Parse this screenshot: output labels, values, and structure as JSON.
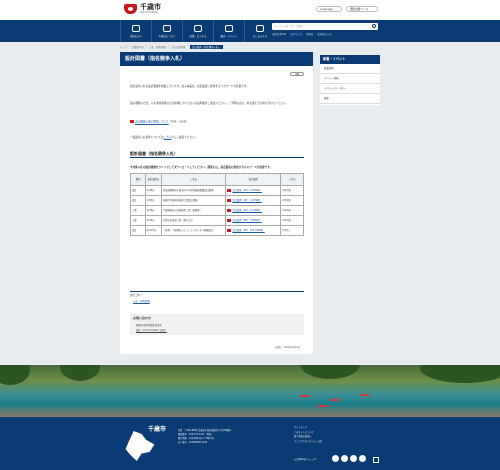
{
  "header": {
    "logo_name": "千歳市",
    "logo_sub": "City of Chitose",
    "language_label": "Language",
    "speech_label": "閲覧支援ツール",
    "search_placeholder": "キーワードを入力して検索",
    "quick_links": [
      "市民生活FAQ",
      "文字サイズ",
      "背景色",
      "音声読み上げ"
    ]
  },
  "nav": {
    "items": [
      {
        "label": "市民の方へ"
      },
      {
        "label": "千歳市について"
      },
      {
        "label": "産業・ビジネス"
      },
      {
        "label": "観光・イベント"
      },
      {
        "label": "もしものとき"
      }
    ]
  },
  "breadcrumb": [
    "トップ",
    "事業者向け",
    "入札・契約情報",
    "入札公告情報",
    "設計図書（指名競争入札）"
  ],
  "page": {
    "title": "設計図書（指名競争入札）",
    "print_label": "印刷",
    "intro_1": "指名競争入札の設計図書を掲載しています。電子納品は、指名業者に配布するパスワードが必要です。",
    "intro_2": "電子閲覧の方法、入札参加資格などの詳細については入札説明書をご確認ください。ご不明な点は、担当課までお問い合わせください。",
    "pdf_link": "設計図書の電子閲覧について",
    "pdf_size": "（PDF：10KB）",
    "notice_prefix": "一般競争入札案件については",
    "notice_link": "こちら",
    "notice_suffix": "からご確認ください。",
    "section_title": "設計図書（指名競争入札）",
    "note": "※対象入札の設計図書をクリックしてダウンロードしてください。閲覧には、指名業者に配布するパスワードが必要です。"
  },
  "table": {
    "headers": [
      "種別",
      "指名通知日",
      "入札名",
      "設計図書",
      "入札日"
    ],
    "rows": [
      {
        "type": "設計",
        "date": "4月8日",
        "name": "北海道開発局千歳市内小中学校施設整備設計業務",
        "doc": "設計図書（ZIP：2,508KB）",
        "bid": "4月18日"
      },
      {
        "type": "設計",
        "date": "4月8日",
        "name": "花園小学校外壁改修工事設計業務",
        "doc": "設計図書（ZIP：1,188KB）",
        "bid": "4月18日"
      },
      {
        "type": "工事",
        "date": "4月8日",
        "name": "千歳駅周辺公共施設等工事（修繕等）",
        "doc": "設計図書（ZIP：2,108KB）",
        "bid": "4月18日"
      },
      {
        "type": "工事",
        "date": "4月8日",
        "name": "市営住宅改修工事（第2工区）",
        "doc": "設計図書（ZIP：1,886KB）",
        "bid": "4月18日"
      },
      {
        "type": "設計",
        "date": "4月10日",
        "name": "（仮称）千歳地区コミュニティセンター整備設計",
        "doc": "設計図書（ZIP：394,556KB）",
        "bid": "5月7日"
      }
    ]
  },
  "related": {
    "title": "カテゴリー",
    "link": "入札・契約情報"
  },
  "contact": {
    "title": "お問い合わせ",
    "dept": "総務部 契約管理課 契約係",
    "phone": "電話：0123-24-0000（直通）"
  },
  "updated": "公開日：2024年4月10日",
  "sidebar": {
    "title": "新着・イベント",
    "items": [
      "新着情報",
      "イベント情報",
      "イベントカレンダー",
      "募集"
    ]
  },
  "footer": {
    "city_name": "千歳市",
    "info_lines": [
      "住所　〒066-8686 北海道千歳市東雲町2丁目34番地",
      "電話番号　0123-24-3131（代表）",
      "開庁時間　平日8時45分〜17時15分",
      "法人番号　2000020012246"
    ],
    "links": [
      "サイトマップ",
      "このサイトについて",
      "個人情報の取扱い",
      "ウェブアクセシビリティ方針"
    ],
    "social_label": "公式SNSをチェック!"
  },
  "colors": {
    "brand_navy": "#0b3b74",
    "accent_red": "#c8161d"
  }
}
